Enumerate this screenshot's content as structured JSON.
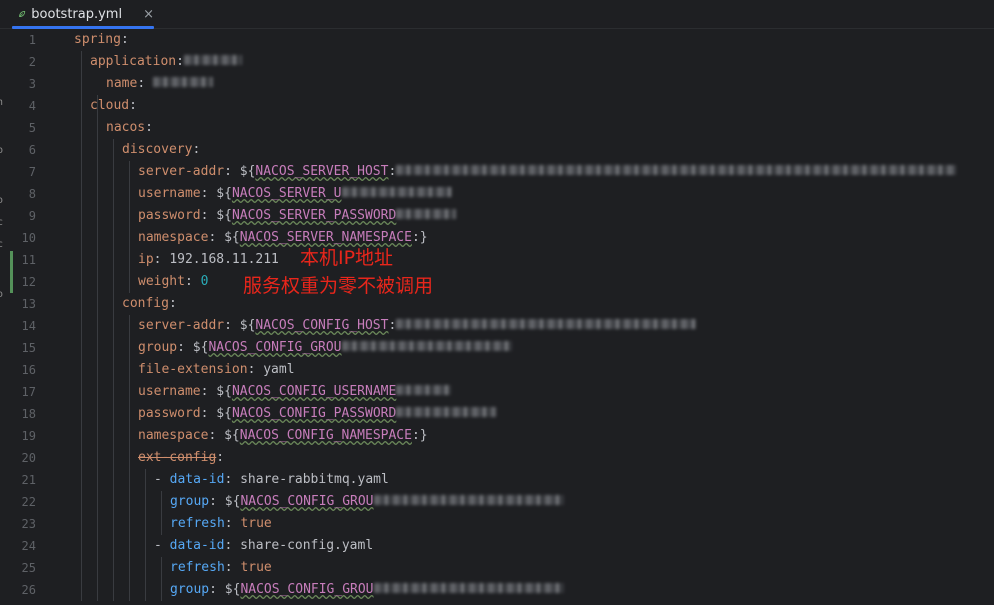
{
  "tab": {
    "filename": "bootstrap.yml",
    "icon": "yaml-leaf-icon",
    "close": "×"
  },
  "left_edge_glyphs": [
    "n",
    "p",
    "o",
    "c",
    "c",
    "o"
  ],
  "annotations": [
    "本机IP地址",
    "服务权重为零不被调用"
  ],
  "lines": [
    {
      "n": "1",
      "t": "spring:"
    },
    {
      "n": "2",
      "t": "application:"
    },
    {
      "n": "3",
      "t": "name: "
    },
    {
      "n": "4",
      "t": "cloud:"
    },
    {
      "n": "5",
      "t": "nacos:"
    },
    {
      "n": "6",
      "t": "discovery:"
    },
    {
      "n": "7",
      "t": "server-addr: ${NACOS_SERVER_HOST:"
    },
    {
      "n": "8",
      "t": "username: ${NACOS_SERVER_U"
    },
    {
      "n": "9",
      "t": "password: ${NACOS_SERVER_PASSWORD"
    },
    {
      "n": "10",
      "t": "namespace: ${NACOS_SERVER_NAMESPACE:}"
    },
    {
      "n": "11",
      "t": "ip: 192.168.11.211"
    },
    {
      "n": "12",
      "t": "weight: 0"
    },
    {
      "n": "13",
      "t": "config:"
    },
    {
      "n": "14",
      "t": "server-addr: ${NACOS_CONFIG_HOST:"
    },
    {
      "n": "15",
      "t": "group: ${NACOS_CONFIG_GROU"
    },
    {
      "n": "16",
      "t": "file-extension: yaml"
    },
    {
      "n": "17",
      "t": "username: ${NACOS_CONFIG_USERNAME"
    },
    {
      "n": "18",
      "t": "password: ${NACOS_CONFIG_PASSWORD"
    },
    {
      "n": "19",
      "t": "namespace: ${NACOS_CONFIG_NAMESPACE:}"
    },
    {
      "n": "20",
      "t": "ext-config:"
    },
    {
      "n": "21",
      "t": "- data-id: share-rabbitmq.yaml"
    },
    {
      "n": "22",
      "t": "group: ${NACOS_CONFIG_GROU"
    },
    {
      "n": "23",
      "t": "refresh: true"
    },
    {
      "n": "24",
      "t": "- data-id: share-config.yaml"
    },
    {
      "n": "25",
      "t": "refresh: true"
    },
    {
      "n": "26",
      "t": "group: ${NACOS_CONFIG_GROU"
    }
  ],
  "seg": {
    "l1k": "spring",
    "l2k": "application",
    "l3k": "name",
    "l3v": "",
    "l4k": "cloud",
    "l5k": "nacos",
    "l6k": "discovery",
    "l7k": "server-addr",
    "l7e": "NACOS_SERVER_HOST",
    "l8k": "username",
    "l8e": "NACOS_SERVER_U",
    "l9k": "password",
    "l9e": "NACOS_SERVER_PASSWORD",
    "l10k": "namespace",
    "l10e": "NACOS_SERVER_NAMESPACE",
    "l11k": "ip",
    "l11v": "192.168.11.211",
    "l12k": "weight",
    "l12v": "0",
    "l13k": "config",
    "l14k": "server-addr",
    "l14e": "NACOS_CONFIG_HOST",
    "l15k": "group",
    "l15e": "NACOS_CONFIG_GROU",
    "l16k": "file-extension",
    "l16v": "yaml",
    "l17k": "username",
    "l17e": "NACOS_CONFIG_USERNAME",
    "l18k": "password",
    "l18e": "NACOS_CONFIG_PASSWORD",
    "l19k": "namespace",
    "l19e": "NACOS_CONFIG_NAMESPACE",
    "l20k": "ext-config",
    "l21k": "data-id",
    "l21v": "share-rabbitmq.yaml",
    "l22k": "group",
    "l22e": "NACOS_CONFIG_GROU",
    "l23k": "refresh",
    "l23v": "true",
    "l24k": "data-id",
    "l24v": "share-config.yaml",
    "l25k": "refresh",
    "l25v": "true",
    "l26k": "group",
    "l26e": "NACOS_CONFIG_GROU"
  }
}
